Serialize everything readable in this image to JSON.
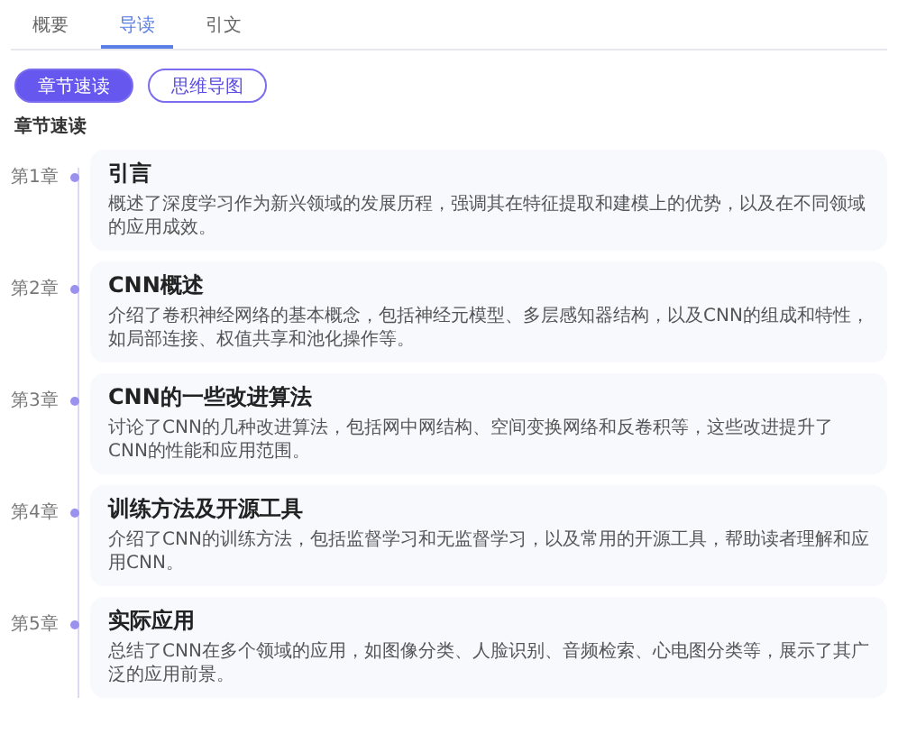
{
  "tabs": [
    {
      "label": "概要",
      "selected": false
    },
    {
      "label": "导读",
      "selected": true
    },
    {
      "label": "引文",
      "selected": false
    }
  ],
  "view_buttons": [
    {
      "label": "章节速读",
      "selected": true
    },
    {
      "label": "思维导图",
      "selected": false
    }
  ],
  "section_label": "章节速读",
  "chapters": [
    {
      "number": "第1章",
      "title": "引言",
      "description": "概述了深度学习作为新兴领域的发展历程，强调其在特征提取和建模上的优势，以及在不同领域的应用成效。"
    },
    {
      "number": "第2章",
      "title": "CNN概述",
      "description": "介绍了卷积神经网络的基本概念，包括神经元模型、多层感知器结构，以及CNN的组成和特性，如局部连接、权值共享和池化操作等。"
    },
    {
      "number": "第3章",
      "title": "CNN的一些改进算法",
      "description": "讨论了CNN的几种改进算法，包括网中网结构、空间变换网络和反卷积等，这些改进提升了CNN的性能和应用范围。"
    },
    {
      "number": "第4章",
      "title": "训练方法及开源工具",
      "description": "介绍了CNN的训练方法，包括监督学习和无监督学习，以及常用的开源工具，帮助读者理解和应用CNN。"
    },
    {
      "number": "第5章",
      "title": "实际应用",
      "description": "总结了CNN在多个领域的应用，如图像分类、人脸识别、音频检索、心电图分类等，展示了其广泛的应用前景。"
    }
  ]
}
